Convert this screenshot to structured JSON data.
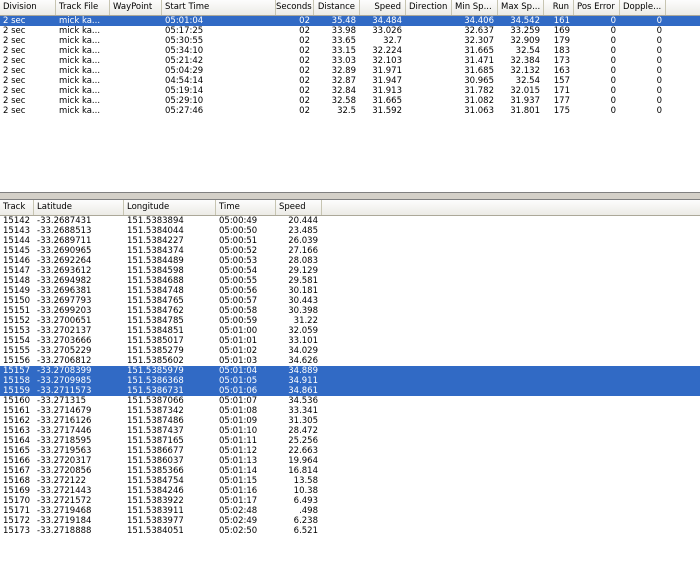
{
  "divisions_table": {
    "columns": [
      "Division",
      "Track File",
      "WayPoint",
      "Start Time",
      "Seconds",
      "Distance",
      "Speed",
      "Direction",
      "Min Sp...",
      "Max Sp...",
      "Run",
      "Pos Error",
      "Dopple..."
    ],
    "rows": [
      [
        "2 sec",
        "mick ka...",
        "",
        "05:01:04",
        "02",
        "35.48",
        "34.484",
        "",
        "34.406",
        "34.542",
        "161",
        "0",
        "0"
      ],
      [
        "2 sec",
        "mick ka...",
        "",
        "05:17:25",
        "02",
        "33.98",
        "33.026",
        "",
        "32.637",
        "33.259",
        "169",
        "0",
        "0"
      ],
      [
        "2 sec",
        "mick ka...",
        "",
        "05:30:55",
        "02",
        "33.65",
        "32.7",
        "",
        "32.307",
        "32.909",
        "179",
        "0",
        "0"
      ],
      [
        "2 sec",
        "mick ka...",
        "",
        "05:34:10",
        "02",
        "33.15",
        "32.224",
        "",
        "31.665",
        "32.54",
        "183",
        "0",
        "0"
      ],
      [
        "2 sec",
        "mick ka...",
        "",
        "05:21:42",
        "02",
        "33.03",
        "32.103",
        "",
        "31.471",
        "32.384",
        "173",
        "0",
        "0"
      ],
      [
        "2 sec",
        "mick ka...",
        "",
        "05:04:29",
        "02",
        "32.89",
        "31.971",
        "",
        "31.685",
        "32.132",
        "163",
        "0",
        "0"
      ],
      [
        "2 sec",
        "mick ka...",
        "",
        "04:54:14",
        "02",
        "32.87",
        "31.947",
        "",
        "30.965",
        "32.54",
        "157",
        "0",
        "0"
      ],
      [
        "2 sec",
        "mick ka...",
        "",
        "05:19:14",
        "02",
        "32.84",
        "31.913",
        "",
        "31.782",
        "32.015",
        "171",
        "0",
        "0"
      ],
      [
        "2 sec",
        "mick ka...",
        "",
        "05:29:10",
        "02",
        "32.58",
        "31.665",
        "",
        "31.082",
        "31.937",
        "177",
        "0",
        "0"
      ],
      [
        "2 sec",
        "mick ka...",
        "",
        "05:27:46",
        "02",
        "32.5",
        "31.592",
        "",
        "31.063",
        "31.801",
        "175",
        "0",
        "0"
      ]
    ],
    "selected_rows": [
      0
    ]
  },
  "track_table": {
    "columns": [
      "Track",
      "Latitude",
      "Longitude",
      "Time",
      "Speed"
    ],
    "rows": [
      [
        "15142",
        "-33.2687431",
        "151.5383894",
        "05:00:49",
        "20.444"
      ],
      [
        "15143",
        "-33.2688513",
        "151.5384044",
        "05:00:50",
        "23.485"
      ],
      [
        "15144",
        "-33.2689711",
        "151.5384227",
        "05:00:51",
        "26.039"
      ],
      [
        "15145",
        "-33.2690965",
        "151.5384374",
        "05:00:52",
        "27.166"
      ],
      [
        "15146",
        "-33.2692264",
        "151.5384489",
        "05:00:53",
        "28.083"
      ],
      [
        "15147",
        "-33.2693612",
        "151.5384598",
        "05:00:54",
        "29.129"
      ],
      [
        "15148",
        "-33.2694982",
        "151.5384688",
        "05:00:55",
        "29.581"
      ],
      [
        "15149",
        "-33.2696381",
        "151.5384748",
        "05:00:56",
        "30.181"
      ],
      [
        "15150",
        "-33.2697793",
        "151.5384765",
        "05:00:57",
        "30.443"
      ],
      [
        "15151",
        "-33.2699203",
        "151.5384762",
        "05:00:58",
        "30.398"
      ],
      [
        "15152",
        "-33.2700651",
        "151.5384785",
        "05:00:59",
        "31.22"
      ],
      [
        "15153",
        "-33.2702137",
        "151.5384851",
        "05:01:00",
        "32.059"
      ],
      [
        "15154",
        "-33.2703666",
        "151.5385017",
        "05:01:01",
        "33.101"
      ],
      [
        "15155",
        "-33.2705229",
        "151.5385279",
        "05:01:02",
        "34.029"
      ],
      [
        "15156",
        "-33.2706812",
        "151.5385602",
        "05:01:03",
        "34.626"
      ],
      [
        "15157",
        "-33.2708399",
        "151.5385979",
        "05:01:04",
        "34.889"
      ],
      [
        "15158",
        "-33.2709985",
        "151.5386368",
        "05:01:05",
        "34.911"
      ],
      [
        "15159",
        "-33.2711573",
        "151.5386731",
        "05:01:06",
        "34.861"
      ],
      [
        "15160",
        "-33.271315",
        "151.5387066",
        "05:01:07",
        "34.536"
      ],
      [
        "15161",
        "-33.2714679",
        "151.5387342",
        "05:01:08",
        "33.341"
      ],
      [
        "15162",
        "-33.2716126",
        "151.5387486",
        "05:01:09",
        "31.305"
      ],
      [
        "15163",
        "-33.2717446",
        "151.5387437",
        "05:01:10",
        "28.472"
      ],
      [
        "15164",
        "-33.2718595",
        "151.5387165",
        "05:01:11",
        "25.256"
      ],
      [
        "15165",
        "-33.2719563",
        "151.5386677",
        "05:01:12",
        "22.663"
      ],
      [
        "15166",
        "-33.2720317",
        "151.5386037",
        "05:01:13",
        "19.964"
      ],
      [
        "15167",
        "-33.2720856",
        "151.5385366",
        "05:01:14",
        "16.814"
      ],
      [
        "15168",
        "-33.272122",
        "151.5384754",
        "05:01:15",
        "13.58"
      ],
      [
        "15169",
        "-33.2721443",
        "151.5384246",
        "05:01:16",
        "10.38"
      ],
      [
        "15170",
        "-33.2721572",
        "151.5383922",
        "05:01:17",
        "6.493"
      ],
      [
        "15171",
        "-33.2719468",
        "151.5383911",
        "05:02:48",
        ".498"
      ],
      [
        "15172",
        "-33.2719184",
        "151.5383977",
        "05:02:49",
        "6.238"
      ],
      [
        "15173",
        "-33.2718888",
        "151.5384051",
        "05:02:50",
        "6.521"
      ]
    ],
    "selected_rows": [
      15,
      16,
      17
    ]
  },
  "colors": {
    "selection": "#316ac5",
    "selection_text": "#ffffff"
  }
}
